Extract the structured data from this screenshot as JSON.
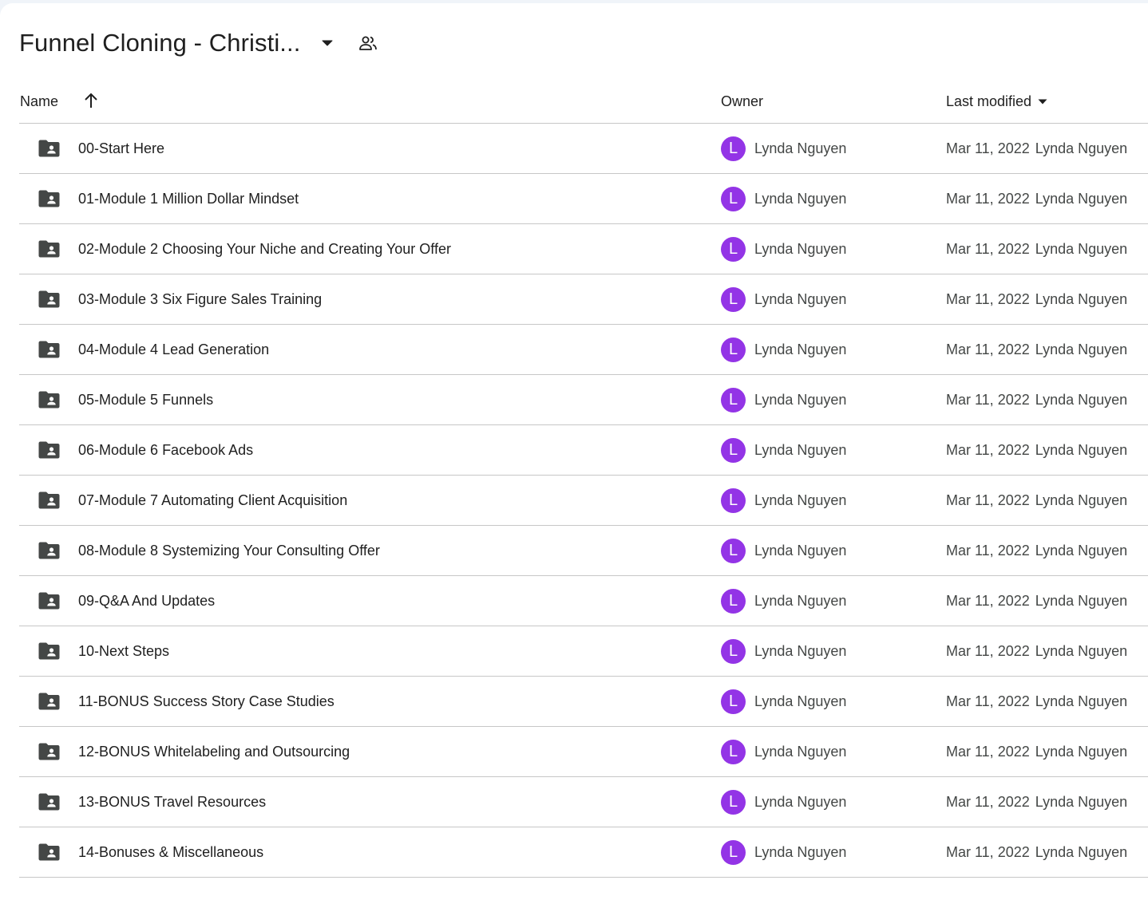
{
  "header": {
    "title": "Funnel Cloning - Christi...",
    "dropdown_icon": "caret-down-icon",
    "shared_icon": "people-icon"
  },
  "columns": {
    "name": "Name",
    "owner": "Owner",
    "modified": "Last modified",
    "sort_direction": "ascending"
  },
  "colors": {
    "avatar": "#9334e6",
    "folder_icon": "#444746",
    "divider": "#c7c7c7"
  },
  "rows": [
    {
      "name": "00-Start Here",
      "owner_initial": "L",
      "owner": "Lynda Nguyen",
      "modified_date": "Mar 11, 2022",
      "modified_by": "Lynda Nguyen"
    },
    {
      "name": "01-Module 1 Million Dollar Mindset",
      "owner_initial": "L",
      "owner": "Lynda Nguyen",
      "modified_date": "Mar 11, 2022",
      "modified_by": "Lynda Nguyen"
    },
    {
      "name": "02-Module 2 Choosing Your Niche and Creating Your Offer",
      "owner_initial": "L",
      "owner": "Lynda Nguyen",
      "modified_date": "Mar 11, 2022",
      "modified_by": "Lynda Nguyen"
    },
    {
      "name": "03-Module 3 Six Figure Sales Training",
      "owner_initial": "L",
      "owner": "Lynda Nguyen",
      "modified_date": "Mar 11, 2022",
      "modified_by": "Lynda Nguyen"
    },
    {
      "name": "04-Module 4 Lead Generation",
      "owner_initial": "L",
      "owner": "Lynda Nguyen",
      "modified_date": "Mar 11, 2022",
      "modified_by": "Lynda Nguyen"
    },
    {
      "name": "05-Module 5 Funnels",
      "owner_initial": "L",
      "owner": "Lynda Nguyen",
      "modified_date": "Mar 11, 2022",
      "modified_by": "Lynda Nguyen"
    },
    {
      "name": "06-Module 6 Facebook Ads",
      "owner_initial": "L",
      "owner": "Lynda Nguyen",
      "modified_date": "Mar 11, 2022",
      "modified_by": "Lynda Nguyen"
    },
    {
      "name": "07-Module 7 Automating Client Acquisition",
      "owner_initial": "L",
      "owner": "Lynda Nguyen",
      "modified_date": "Mar 11, 2022",
      "modified_by": "Lynda Nguyen"
    },
    {
      "name": "08-Module 8 Systemizing Your Consulting Offer",
      "owner_initial": "L",
      "owner": "Lynda Nguyen",
      "modified_date": "Mar 11, 2022",
      "modified_by": "Lynda Nguyen"
    },
    {
      "name": "09-Q&A And Updates",
      "owner_initial": "L",
      "owner": "Lynda Nguyen",
      "modified_date": "Mar 11, 2022",
      "modified_by": "Lynda Nguyen"
    },
    {
      "name": "10-Next Steps",
      "owner_initial": "L",
      "owner": "Lynda Nguyen",
      "modified_date": "Mar 11, 2022",
      "modified_by": "Lynda Nguyen"
    },
    {
      "name": "11-BONUS Success Story Case Studies",
      "owner_initial": "L",
      "owner": "Lynda Nguyen",
      "modified_date": "Mar 11, 2022",
      "modified_by": "Lynda Nguyen"
    },
    {
      "name": "12-BONUS Whitelabeling and Outsourcing",
      "owner_initial": "L",
      "owner": "Lynda Nguyen",
      "modified_date": "Mar 11, 2022",
      "modified_by": "Lynda Nguyen"
    },
    {
      "name": "13-BONUS Travel Resources",
      "owner_initial": "L",
      "owner": "Lynda Nguyen",
      "modified_date": "Mar 11, 2022",
      "modified_by": "Lynda Nguyen"
    },
    {
      "name": "14-Bonuses & Miscellaneous",
      "owner_initial": "L",
      "owner": "Lynda Nguyen",
      "modified_date": "Mar 11, 2022",
      "modified_by": "Lynda Nguyen"
    }
  ]
}
